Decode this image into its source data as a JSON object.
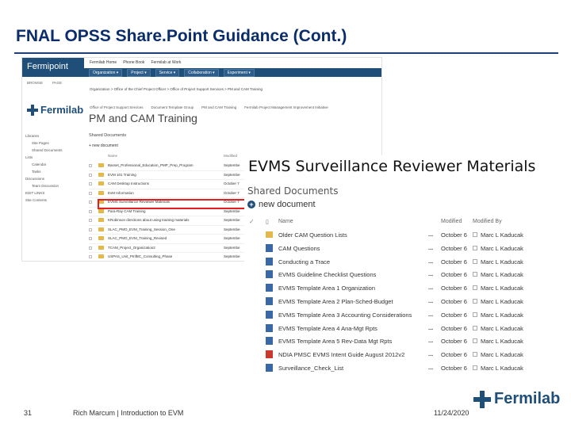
{
  "slide": {
    "title": "FNAL OPSS Share.Point Guidance (Cont.)",
    "page_number": "31",
    "author": "Rich Marcum | Introduction to EVM",
    "date": "11/24/2020",
    "footer_logo_text": "Fermilab"
  },
  "sharepoint": {
    "brand": "Fermipoint",
    "suite_links": [
      "Fermilab Home",
      "Phone Book",
      "Fermilab at Work"
    ],
    "nav_items": [
      "Organization ▾",
      "Project ▾",
      "Service ▾",
      "Collaboration ▾",
      "Experiment ▾"
    ],
    "browse_tabs": [
      "BROWSE",
      "PAGE"
    ],
    "breadcrumb": "Organization > Office of the Chief Project Officer > Office of Project Support Services > PM and CAM Training",
    "logo_text": "Fermilab",
    "site_tabs": [
      "Office of Project Support Services",
      "Document Template Group",
      "PM and CAM Training",
      "Fermilab Project Management Improvement Initiative"
    ],
    "site_title": "PM and CAM Training",
    "quick_launch": [
      {
        "label": "Libraries",
        "indent": false
      },
      {
        "label": "Site Pages",
        "indent": true
      },
      {
        "label": "Shared Documents",
        "indent": true
      },
      {
        "label": "Lists",
        "indent": false
      },
      {
        "label": "Calendar",
        "indent": true
      },
      {
        "label": "Tasks",
        "indent": true
      },
      {
        "label": "Discussions",
        "indent": false
      },
      {
        "label": "Team Discussion",
        "indent": true
      },
      {
        "label": "EDIT LINKS",
        "indent": false
      },
      {
        "label": "Site Contents",
        "indent": false
      }
    ],
    "doc_library": "Shared Documents",
    "new_document": "+ new document",
    "col_name": "Name",
    "col_modified": "Modified",
    "rows": [
      {
        "name": "Basset_Professional_Education_PMP_Prep_Program",
        "modified": "Septembe"
      },
      {
        "name": "EVM 101 Training",
        "modified": "Septembe"
      },
      {
        "name": "CAM Desktop Instructions",
        "modified": "October 7"
      },
      {
        "name": "EvM Information",
        "modified": "October 7"
      },
      {
        "name": "EVMS Surveillance Reviewer Materials",
        "modified": "October 7"
      },
      {
        "name": "Para-Ray CAM Training",
        "modified": "Septembe"
      },
      {
        "name": "KRobinson directions about using training materials",
        "modified": "Septembe"
      },
      {
        "name": "SLAC_PMO_EVM_Training_Session_One",
        "modified": "Septembe"
      },
      {
        "name": "SLAC_PMO_EVM_Training_Revised",
        "modified": "Septembe"
      },
      {
        "name": "TCAM_Project_Organization2",
        "modified": "Septembe"
      },
      {
        "name": "USPAS_Unit_PInfBC_Consulting_Phase",
        "modified": "Septembe"
      }
    ]
  },
  "zoom": {
    "title": "EVMS Surveillance Reviewer Materials",
    "shared_documents": "Shared Documents",
    "new_document": "new document",
    "col_name": "Name",
    "col_modified": "Modified",
    "col_modified_by": "Modified By",
    "rows": [
      {
        "icon": "folder",
        "name": "Older CAM Question Lists",
        "modified": "October 6",
        "by": "Marc L Kaducak"
      },
      {
        "icon": "doc",
        "name": "CAM Questions",
        "modified": "October 6",
        "by": "Marc L Kaducak"
      },
      {
        "icon": "doc",
        "name": "Conducting a Trace",
        "modified": "October 6",
        "by": "Marc L Kaducak"
      },
      {
        "icon": "doc",
        "name": "EVMS Guideline Checklist Questions",
        "modified": "October 6",
        "by": "Marc L Kaducak"
      },
      {
        "icon": "doc",
        "name": "EVMS Template Area 1 Organization",
        "modified": "October 6",
        "by": "Marc L Kaducak"
      },
      {
        "icon": "doc",
        "name": "EVMS Template Area 2 Plan-Sched-Budget",
        "modified": "October 6",
        "by": "Marc L Kaducak"
      },
      {
        "icon": "doc",
        "name": "EVMS Template Area 3 Accounting Considerations",
        "modified": "October 6",
        "by": "Marc L Kaducak"
      },
      {
        "icon": "doc",
        "name": "EVMS Template Area 4 Ana-Mgt Rpts",
        "modified": "October 6",
        "by": "Marc L Kaducak"
      },
      {
        "icon": "doc",
        "name": "EVMS Template Area 5 Rev-Data Mgt Rpts",
        "modified": "October 6",
        "by": "Marc L Kaducak"
      },
      {
        "icon": "pdf",
        "name": "NDIA PMSC EVMS Intent Guide August 2012v2",
        "modified": "October 6",
        "by": "Marc L Kaducak"
      },
      {
        "icon": "doc",
        "name": "Surveillance_Check_List",
        "modified": "October 6",
        "by": "Marc L Kaducak"
      }
    ]
  }
}
